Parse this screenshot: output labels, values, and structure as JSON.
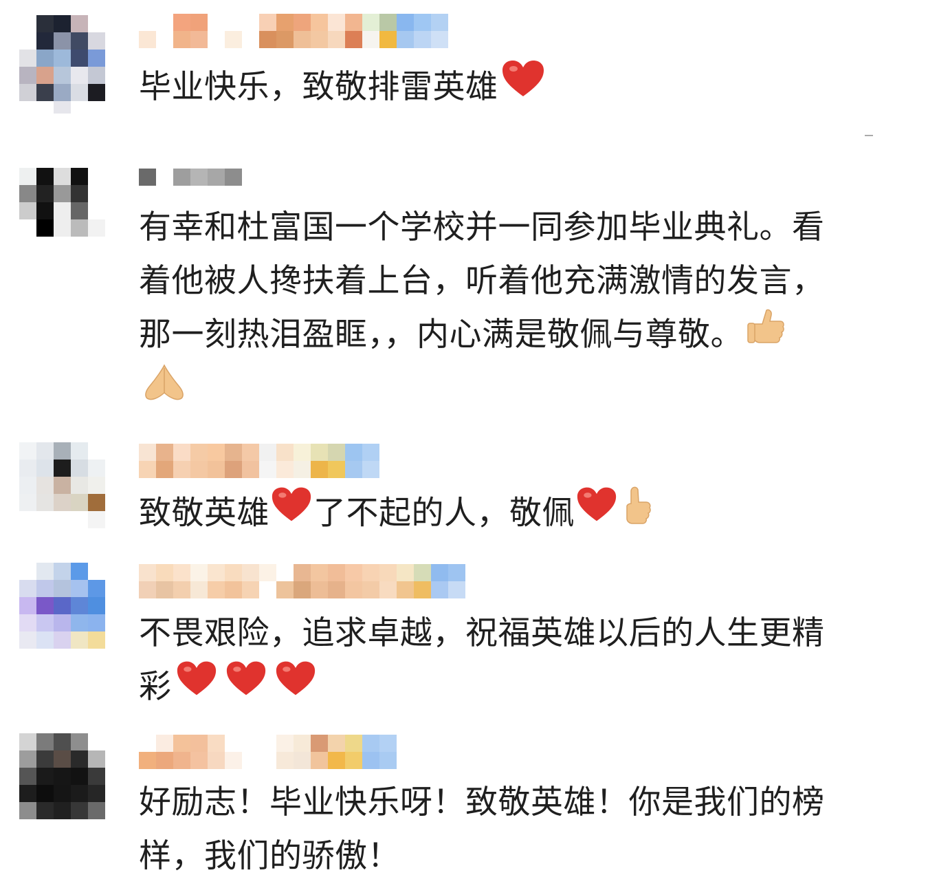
{
  "comments": [
    {
      "text": "毕业快乐，致敬排雷英雄",
      "emojis": [
        "heart-emoji"
      ]
    },
    {
      "text_line1": "有幸和杜富国一个学校并一同参加毕业典礼。看",
      "text_line2": "着他被人搀扶着上台，听着他充满激情的发言，",
      "text_line3": "那一刻热泪盈眶，，内心满是敬佩与尊敬。",
      "emojis": [
        "thumbs-up-emoji",
        "folded-hands-emoji"
      ]
    },
    {
      "text_a": "致敬英雄",
      "text_b": "了不起的人，敬佩",
      "emojis": [
        "heart-emoji",
        "heart-emoji",
        "thumbs-up-emoji"
      ]
    },
    {
      "text_line1": "不畏艰险，追求卓越，祝福英雄以后的人生更精",
      "text_line2": "彩",
      "emojis": [
        "heart-emoji",
        "heart-emoji",
        "heart-emoji"
      ]
    },
    {
      "text_line1": "好励志！毕业快乐呀！致敬英雄！你是我们的榜",
      "text_line2": "样，我们的骄傲！"
    }
  ],
  "colors": {
    "text": "#1f1f1f",
    "heart": "#e0332e",
    "skin": "#f2c48a"
  }
}
